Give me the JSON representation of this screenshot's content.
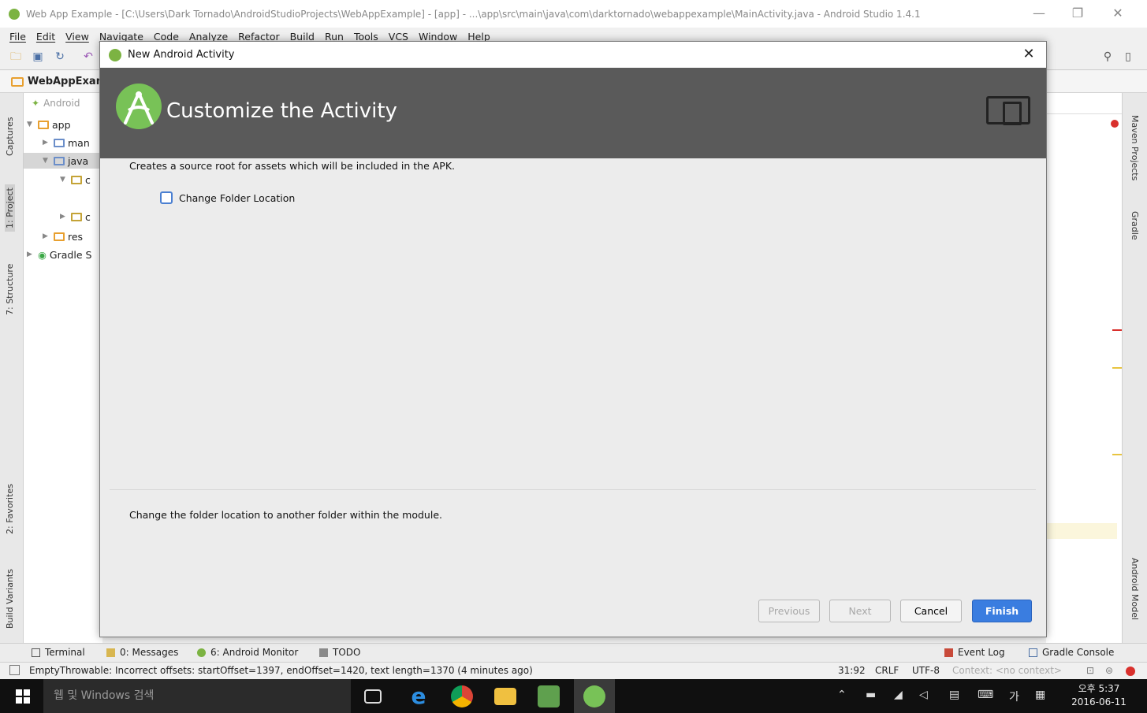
{
  "window": {
    "title": "Web App Example - [C:\\Users\\Dark Tornado\\AndroidStudioProjects\\WebAppExample] - [app] - ...\\app\\src\\main\\java\\com\\darktornado\\webappexample\\MainActivity.java - Android Studio 1.4.1",
    "minimize": "—",
    "restore": "❐",
    "close": "✕"
  },
  "menu": [
    "File",
    "Edit",
    "View",
    "Navigate",
    "Code",
    "Analyze",
    "Refactor",
    "Build",
    "Run",
    "Tools",
    "VCS",
    "Window",
    "Help"
  ],
  "breadcrumb": "WebAppExam",
  "left_tabs": [
    "Captures",
    "1: Project",
    "7: Structure",
    "2: Favorites",
    "Build Variants"
  ],
  "right_tabs": [
    "Maven Projects",
    "Gradle",
    "Android Model"
  ],
  "project_tree": {
    "view": "Android",
    "items": [
      {
        "label": "app",
        "arrow": "▼"
      },
      {
        "label": "man",
        "arrow": "▶"
      },
      {
        "label": "java",
        "arrow": "▼"
      },
      {
        "label": "c",
        "arrow": "▼"
      },
      {
        "label": "c",
        "arrow": "▶"
      },
      {
        "label": "res",
        "arrow": "▶"
      },
      {
        "label": "Gradle S",
        "arrow": "▶"
      }
    ]
  },
  "dialog": {
    "title": "New Android Activity",
    "close": "✕",
    "heading": "Customize the Activity",
    "description": "Creates a source root for assets which will be included in the APK.",
    "checkbox_label": "Change Folder Location",
    "checkbox_checked": false,
    "help_text": "Change the folder location to another folder within the module.",
    "buttons": {
      "previous": "Previous",
      "next": "Next",
      "cancel": "Cancel",
      "finish": "Finish"
    }
  },
  "bottom_tools": {
    "terminal": "Terminal",
    "messages": "0: Messages",
    "android_monitor": "6: Android Monitor",
    "todo": "TODO",
    "event_log": "Event Log",
    "gradle_console": "Gradle Console"
  },
  "status": {
    "message": "EmptyThrowable: Incorrect offsets: startOffset=1397, endOffset=1420, text length=1370 (4 minutes ago)",
    "position": "31:92",
    "line_sep": "CRLF",
    "encoding": "UTF-8",
    "context": "Context: <no context>"
  },
  "taskbar": {
    "search_placeholder": "웹 및 Windows 검색",
    "time": "오후 5:37",
    "date": "2016-06-11",
    "ime": "가"
  },
  "colors": {
    "accent": "#3a7de0",
    "android_green": "#78c257",
    "dialog_header": "#5a5a5a"
  }
}
